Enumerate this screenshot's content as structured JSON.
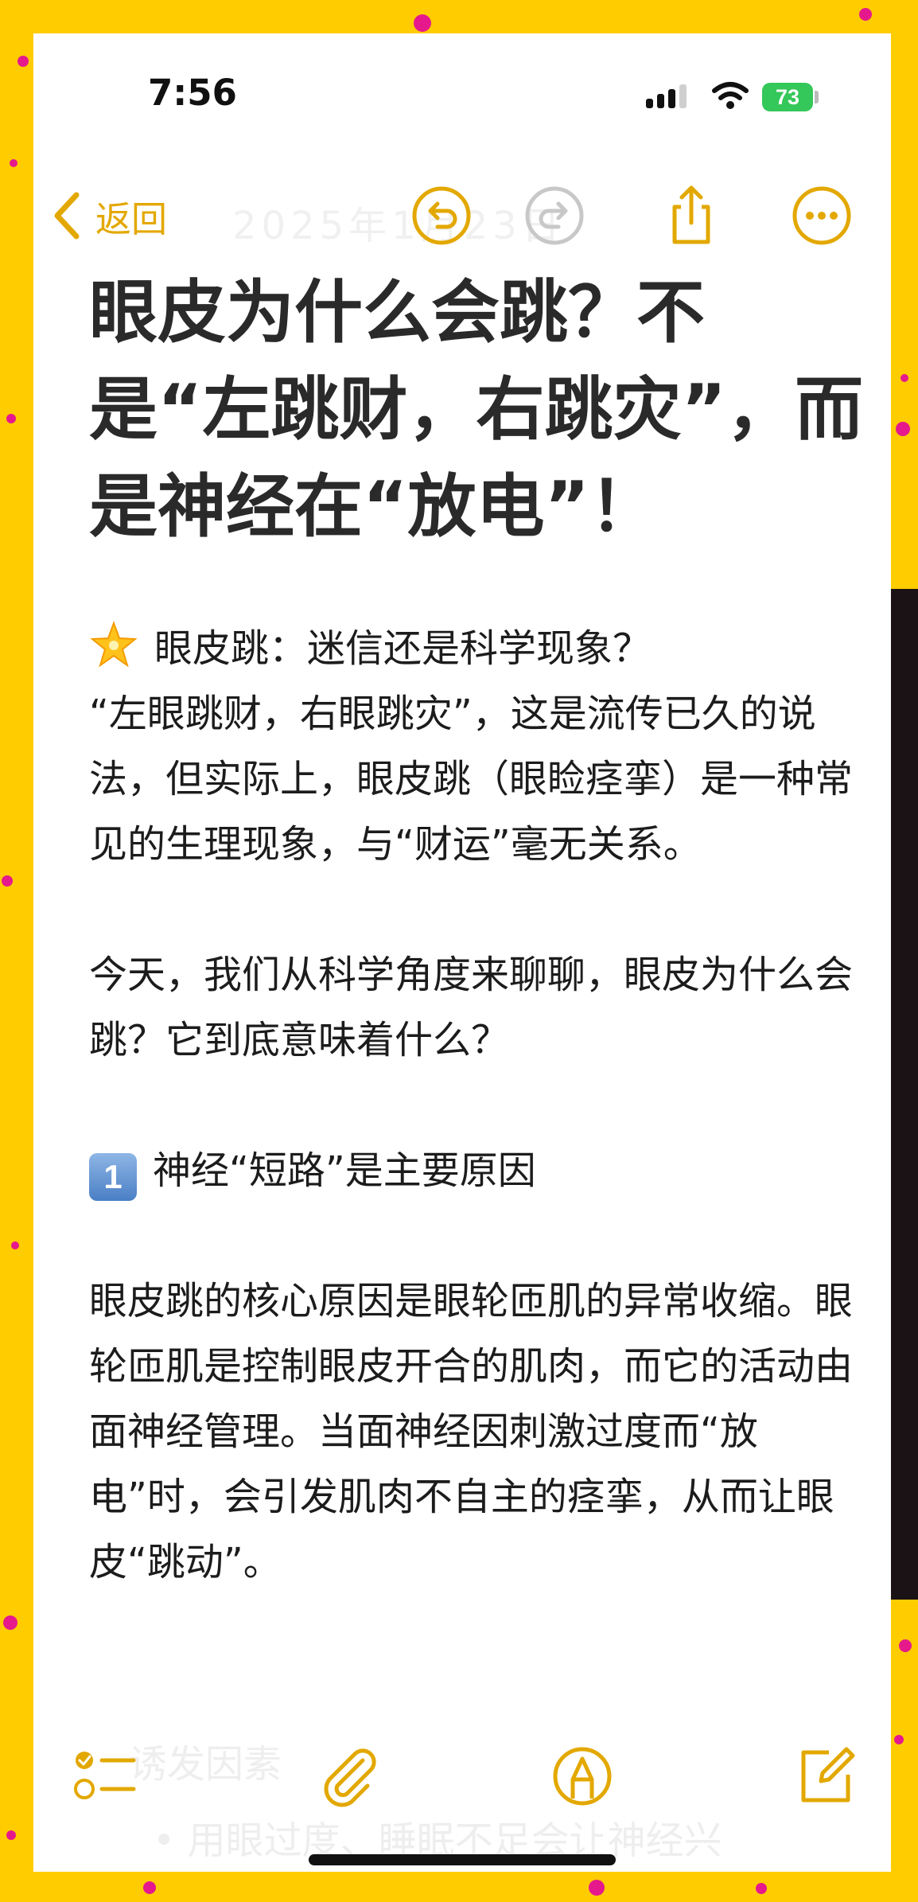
{
  "status_bar": {
    "time": "7:56",
    "battery": "73"
  },
  "nav": {
    "back_label": "返回",
    "faint_date": "2025年1月23日"
  },
  "note": {
    "title": "眼皮为什么会跳？不是“左跳财，右跳灾”，而是神经在“放电”！",
    "section1_heading": "眼皮跳：迷信还是科学现象？",
    "section1_body_a": "“左眼跳财，右眼跳灾”，这是流传已久的说法，但实际上，眼皮跳（眼睑痉挛）是一种常见的生理现象，与“财运”毫无关系。",
    "section1_body_b": "今天，我们从科学角度来聊聊，眼皮为什么会跳？它到底意味着什么？",
    "section2_keycap": "1",
    "section2_heading": "神经“短路”是主要原因",
    "section2_body": "眼皮跳的核心原因是眼轮匝肌的异常收缩。眼轮匝肌是控制眼皮开合的肌肉，而它的活动由面神经管理。当面神经因刺激过度而“放电”时，会引发肌肉不自主的痉挛，从而让眼皮“跳动”。",
    "faded_line_1": "诱发因素",
    "faded_line_2": "• 用眼过度、睡眠不足会让神经兴"
  },
  "icons": {
    "back": "chevron-left-icon",
    "undo": "undo-icon",
    "redo": "redo-icon",
    "share": "share-icon",
    "more": "more-icon",
    "checklist": "checklist-icon",
    "attachment": "paperclip-icon",
    "markup": "markup-pen-icon",
    "compose": "compose-icon"
  },
  "colors": {
    "accent": "#E3A800",
    "disabled": "#C8C8C8",
    "background": "#FFCC00",
    "decor": "#E6198C",
    "battery": "#34C759"
  }
}
